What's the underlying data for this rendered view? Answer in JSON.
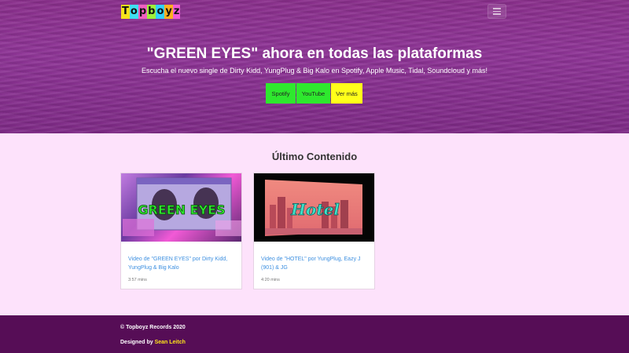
{
  "navbar": {
    "logo_letters": [
      "T",
      "o",
      "p",
      "b",
      "o",
      "y",
      "z"
    ],
    "logo_colors": [
      "#f7e21a",
      "#3ee0f0",
      "#f060c0",
      "#9ef03a",
      "#30d0ff",
      "#ffb020",
      "#f05ad8"
    ],
    "menu_icon": "hamburger-icon"
  },
  "hero": {
    "title": "\"GREEN EYES\" ahora en todas las plataformas",
    "subtitle": "Escucha el nuevo single de Dirty Kidd, YungPlug & Big Kalo en Spotify, Apple Music, Tidal, Soundcloud y más!",
    "buttons": {
      "spotify": "Spotify",
      "youtube": "YouTube",
      "more": "Ver más"
    }
  },
  "content": {
    "section_title": "Último Contenido",
    "cards": [
      {
        "thumb_text": "GREEN EYES",
        "link": "Video de \"GREEN EYES\" por Dirty Kidd, YungPlug & Big Kalo",
        "meta": "3:57 mins"
      },
      {
        "thumb_text": "Hotel",
        "link": "Video de \"HOTEL\" por YungPlug, Eazy J (901) & JG",
        "meta": "4:20 mins"
      }
    ]
  },
  "footer": {
    "copyright": "© Topboyz Records 2020",
    "designed_prefix": "Designed by",
    "designer": "Sean Leitch"
  },
  "colors": {
    "accent_green": "#2ee82e",
    "accent_yellow": "#ffff1a",
    "footer_bg": "#560d56",
    "link": "#3c8fe0"
  }
}
